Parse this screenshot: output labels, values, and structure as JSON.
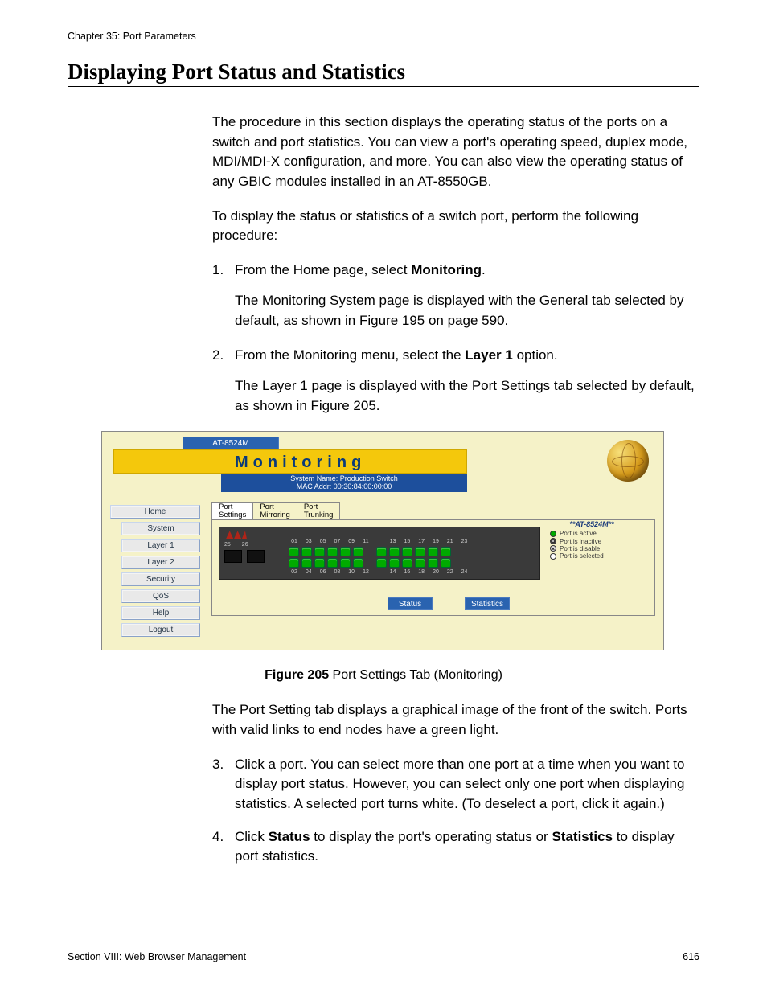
{
  "header": {
    "chapter": "Chapter 35: Port Parameters"
  },
  "title": "Displaying Port Status and Statistics",
  "paragraphs": {
    "intro1": "The procedure in this section displays the operating status of the ports on a switch and port statistics. You can view a port's operating speed, duplex mode, MDI/MDI-X configuration, and more. You can also view the operating status of any GBIC modules installed in an AT-8550GB.",
    "intro2": "To display the status or statistics of a switch port, perform the following procedure:"
  },
  "steps": {
    "s1_pre": "From the Home page, select ",
    "s1_bold": "Monitoring",
    "s1_post": ".",
    "s1_sub": "The Monitoring System page is displayed with the General tab selected by default, as shown in Figure 195 on page 590.",
    "s2_pre": "From the Monitoring menu, select the ",
    "s2_bold": "Layer 1",
    "s2_post": " option.",
    "s2_sub": "The Layer 1 page is displayed with the Port Settings tab selected by default, as shown in Figure 205.",
    "after_fig": "The Port Setting tab displays a graphical image of the front of the switch. Ports with valid links to end nodes have a green light.",
    "s3": "Click a port. You can select more than one port at a time when you want to display port status. However, you can select only one port when displaying statistics. A selected port turns white. (To deselect a port, click it again.)",
    "s4_pre": "Click ",
    "s4_b1": "Status",
    "s4_mid": " to display the port's operating status or ",
    "s4_b2": "Statistics",
    "s4_post": " to display port statistics."
  },
  "figure": {
    "caption_bold": "Figure 205",
    "caption_rest": "  Port Settings Tab (Monitoring)"
  },
  "app": {
    "model_strip": "AT-8524M",
    "title": "Monitoring",
    "sys_line1": "System Name: Production Switch",
    "sys_line2": "MAC Addr: 00:30:84:00:00:00",
    "nav": {
      "home": "Home",
      "system": "System",
      "layer1": "Layer 1",
      "layer2": "Layer 2",
      "security": "Security",
      "qos": "QoS",
      "help": "Help",
      "logout": "Logout"
    },
    "tabs": {
      "port_settings": "Port\nSettings",
      "port_mirroring": "Port\nMirroring",
      "port_trunking": "Port\nTrunking"
    },
    "uplinks": {
      "p25": "25",
      "p26": "26"
    },
    "top_ports": [
      "01",
      "03",
      "05",
      "07",
      "09",
      "11",
      "13",
      "15",
      "17",
      "19",
      "21",
      "23"
    ],
    "bottom_ports": [
      "02",
      "04",
      "06",
      "08",
      "10",
      "12",
      "14",
      "16",
      "18",
      "20",
      "22",
      "24"
    ],
    "legend": {
      "model": "**AT-8524M**",
      "active": "Port is active",
      "inactive": "Port is inactive",
      "disable": "Port is disable",
      "selected": "Port is selected"
    },
    "buttons": {
      "status": "Status",
      "statistics": "Statistics"
    }
  },
  "footer": {
    "section": "Section VIII: Web Browser Management",
    "page": "616"
  }
}
